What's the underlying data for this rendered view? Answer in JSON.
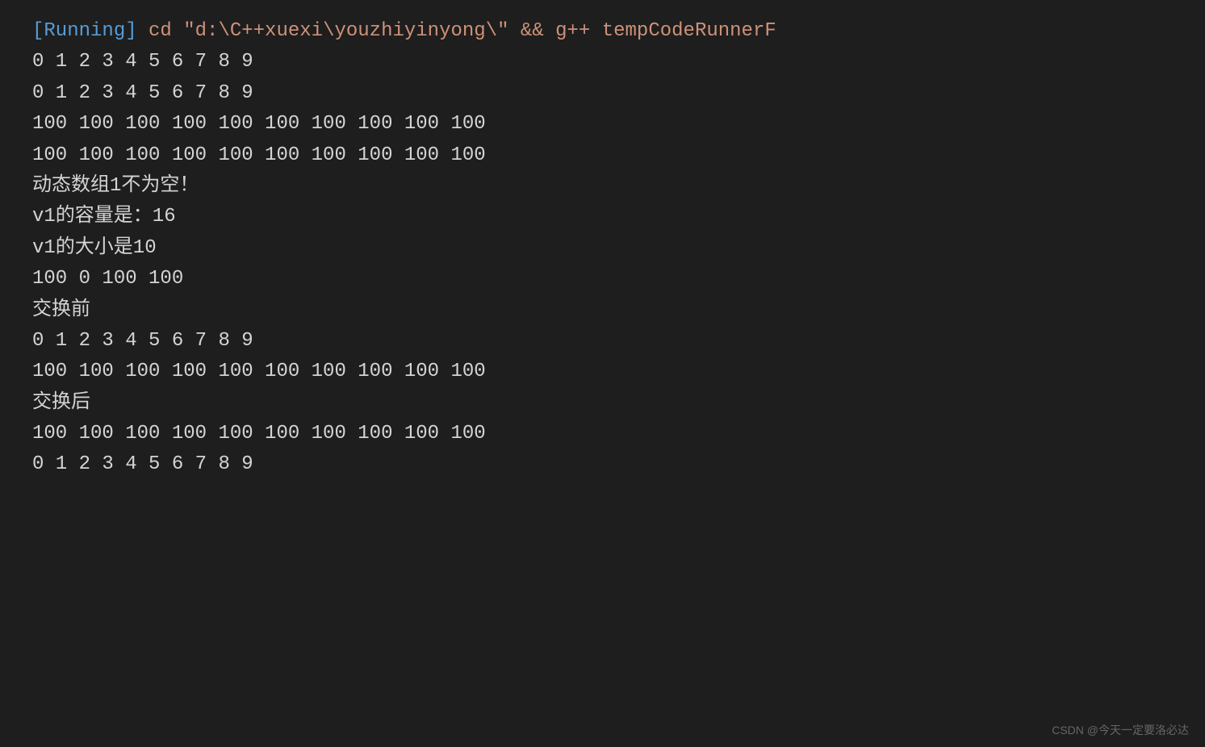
{
  "terminal": {
    "running_label": "[Running]",
    "command": " cd \"d:\\C++xuexi\\youzhiyinyong\\\" && g++ tempCodeRunnerF",
    "lines": [
      "0 1 2 3 4 5 6 7 8 9 ",
      "0 1 2 3 4 5 6 7 8 9 ",
      "100 100 100 100 100 100 100 100 100 100 ",
      "100 100 100 100 100 100 100 100 100 100 ",
      "动态数组1不为空！",
      "v1的容量是：16",
      "v1的大小是10",
      "100 0 100 100 ",
      "交换前",
      "0 1 2 3 4 5 6 7 8 9 ",
      "100 100 100 100 100 100 100 100 100 100 ",
      "交换后",
      "100 100 100 100 100 100 100 100 100 100 ",
      "0 1 2 3 4 5 6 7 8 9 "
    ]
  },
  "watermark": "CSDN @今天一定要洛必达"
}
